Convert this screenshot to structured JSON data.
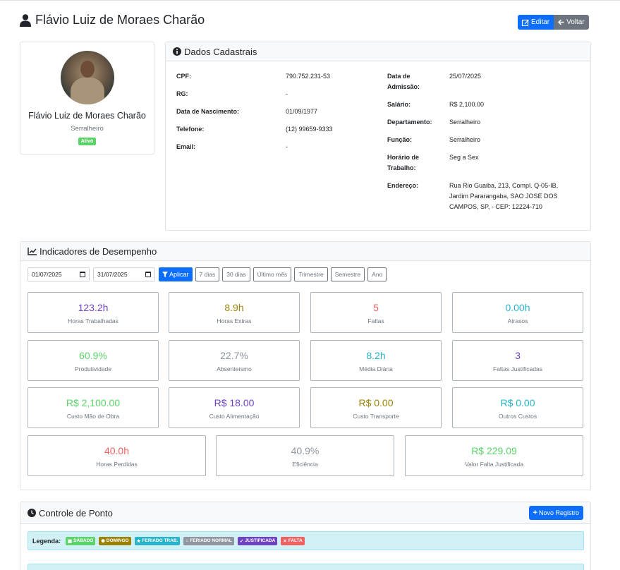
{
  "header": {
    "employee_name": "Flávio Luiz de Moraes Charão",
    "edit_label": "Editar",
    "back_label": "Voltar"
  },
  "profile": {
    "name": "Flávio Luiz de Moraes Charão",
    "role": "Serralheiro",
    "status": "Ativo"
  },
  "details": {
    "title": "Dados Cadastrais",
    "left": [
      {
        "label": "CPF:",
        "value": "790.752.231-53"
      },
      {
        "label": "RG:",
        "value": "-"
      },
      {
        "label": "Data de Nascimento:",
        "value": "01/09/1977"
      },
      {
        "label": "Telefone:",
        "value": "(12) 99659-9333"
      },
      {
        "label": "Email:",
        "value": "-"
      }
    ],
    "right": [
      {
        "label": "Data de Admissão:",
        "value": "25/07/2025"
      },
      {
        "label": "Salário:",
        "value": "R$ 2,100.00"
      },
      {
        "label": "Departamento:",
        "value": "Serralheiro"
      },
      {
        "label": "Função:",
        "value": "Serralheiro"
      },
      {
        "label": "Horário de Trabalho:",
        "value": "Seg a Sex"
      },
      {
        "label": "Endereço:",
        "value": "Rua Rio Guaiba, 213, Compl. Q-05-IB, Jardim Pararangaba, SAO JOSE DOS CAMPOS, SP, - CEP: 12224-710"
      }
    ]
  },
  "performance": {
    "title": "Indicadores de Desempenho",
    "date_start": "01/07/2025",
    "date_end": "31/07/2025",
    "apply_label": "Aplicar",
    "quick_filters": [
      "7 dias",
      "30 dias",
      "Último mês",
      "Trimestre",
      "Semestre",
      "Ano"
    ],
    "metrics": [
      {
        "value": "123.2h",
        "label": "Horas Trabalhadas",
        "color": "#6f42c1"
      },
      {
        "value": "8.9h",
        "label": "Horas Extras",
        "color": "#9a8206"
      },
      {
        "value": "5",
        "label": "Faltas",
        "color": "#f06060"
      },
      {
        "value": "0.00h",
        "label": "Atrasos",
        "color": "#27b3c9"
      },
      {
        "value": "60.9%",
        "label": "Produtividade",
        "color": "#5bd36a"
      },
      {
        "value": "22.7%",
        "label": "Absenteísmo",
        "color": "#8f96a0"
      },
      {
        "value": "8.2h",
        "label": "Média Diária",
        "color": "#27b3c9"
      },
      {
        "value": "3",
        "label": "Faltas Justificadas",
        "color": "#6f42c1"
      },
      {
        "value": "R$ 2,100.00",
        "label": "Custo Mão de Obra",
        "color": "#5bd36a"
      },
      {
        "value": "R$ 18.00",
        "label": "Custo Alimentação",
        "color": "#6f42c1"
      },
      {
        "value": "R$ 0.00",
        "label": "Custo Transporte",
        "color": "#9a8206"
      },
      {
        "value": "R$ 0.00",
        "label": "Outros Custos",
        "color": "#27b3c9"
      },
      {
        "value": "40.0h",
        "label": "Horas Perdidas",
        "color": "#f06060"
      },
      {
        "value": "40.9%",
        "label": "Eficiência",
        "color": "#8f96a0"
      },
      {
        "value": "R$ 229.09",
        "label": "Valor Falta Justificada",
        "color": "#5bd36a"
      }
    ]
  },
  "ponto": {
    "title": "Controle de Ponto",
    "new_label": "Novo Registro",
    "legend_label": "Legenda:",
    "legend": [
      {
        "label": "SÁBADO",
        "color": "#5bd36a",
        "icon": "calendar-icon"
      },
      {
        "label": "DOMINGO",
        "color": "#9a8206",
        "icon": "sun-icon"
      },
      {
        "label": "FERIADO TRAB.",
        "color": "#27b3c9",
        "icon": "star-icon"
      },
      {
        "label": "FERIADO NORMAL",
        "color": "#8f96a0",
        "icon": "home-icon"
      },
      {
        "label": "JUSTIFICADA",
        "color": "#6f42c1",
        "icon": "check-icon"
      },
      {
        "label": "FALTA",
        "color": "#f06060",
        "icon": "times-icon"
      }
    ]
  }
}
